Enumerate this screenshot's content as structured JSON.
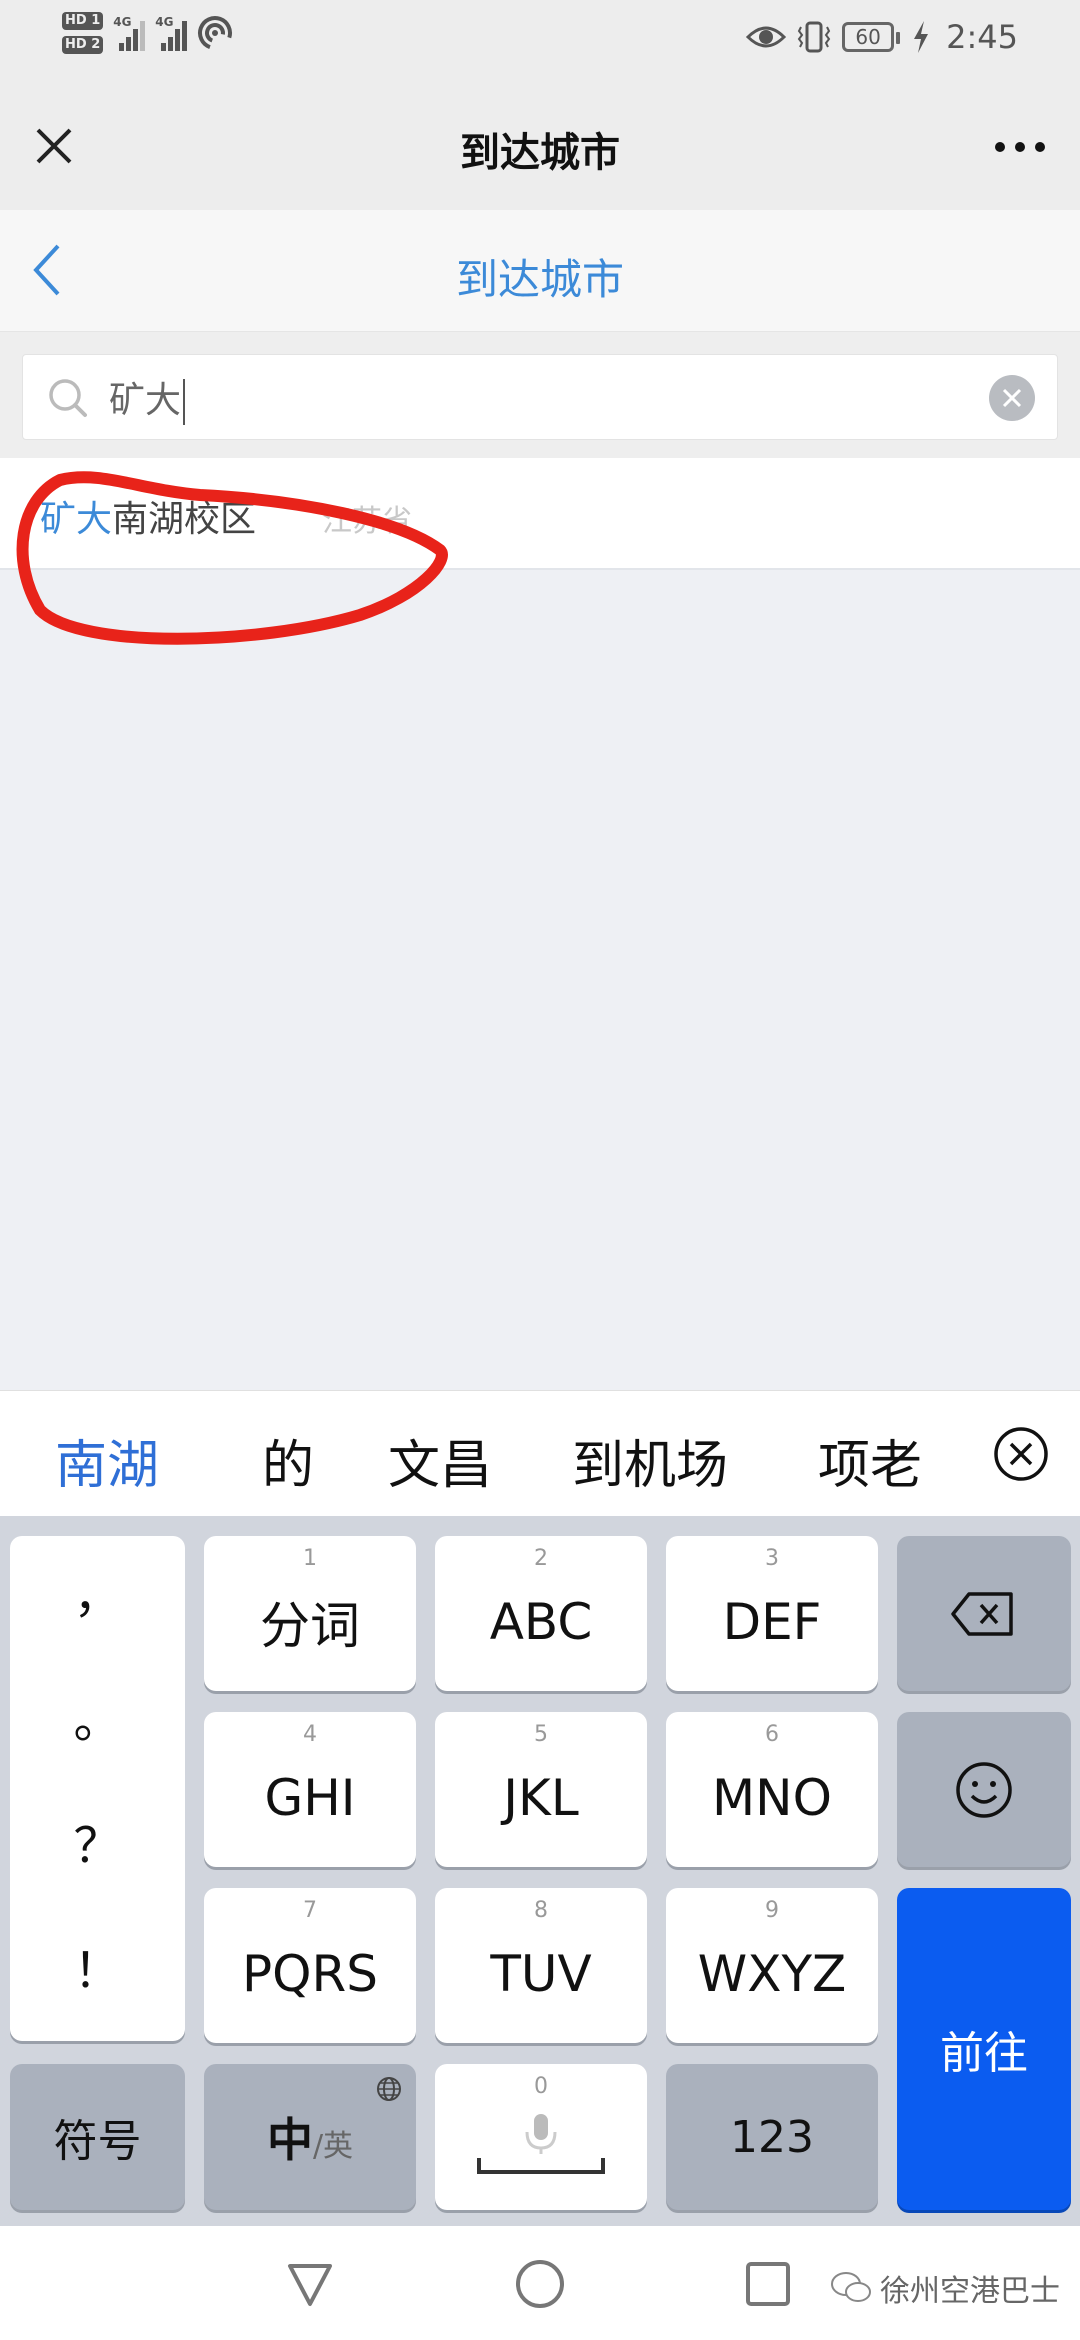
{
  "status_bar": {
    "sim1": "HD 1",
    "sim2": "HD 2",
    "network1": "4G",
    "network2": "4G",
    "battery": "60",
    "time": "2:45"
  },
  "header": {
    "title": "到达城市",
    "close_icon": "close-icon",
    "more_icon": "more-icon"
  },
  "subnav": {
    "title": "到达城市",
    "back_icon": "chevron-left-icon"
  },
  "search": {
    "value": "矿大",
    "placeholder": "",
    "clear_icon": "clear-icon"
  },
  "results": [
    {
      "highlight": "矿大",
      "rest": "南湖校区",
      "province": "江苏省"
    }
  ],
  "candidates": {
    "items": [
      "南湖",
      "的",
      "文昌",
      "到机场",
      "项老"
    ],
    "active_index": 0
  },
  "keyboard": {
    "punct": [
      "，",
      "。",
      "？",
      "！"
    ],
    "keys": [
      {
        "num": "1",
        "label": "分词"
      },
      {
        "num": "2",
        "label": "ABC"
      },
      {
        "num": "3",
        "label": "DEF"
      },
      {
        "num": "4",
        "label": "GHI"
      },
      {
        "num": "5",
        "label": "JKL"
      },
      {
        "num": "6",
        "label": "MNO"
      },
      {
        "num": "7",
        "label": "PQRS"
      },
      {
        "num": "8",
        "label": "TUV"
      },
      {
        "num": "9",
        "label": "WXYZ"
      }
    ],
    "symbols": "符号",
    "lang_main": "中",
    "lang_alt": "/英",
    "space_num": "0",
    "num_mode": "123",
    "go": "前往"
  },
  "watermark": "徐州空港巴士",
  "colors": {
    "accent_blue": "#3c8ad8",
    "go_button": "#0b5cf0",
    "annotation_red": "#e8231a"
  }
}
